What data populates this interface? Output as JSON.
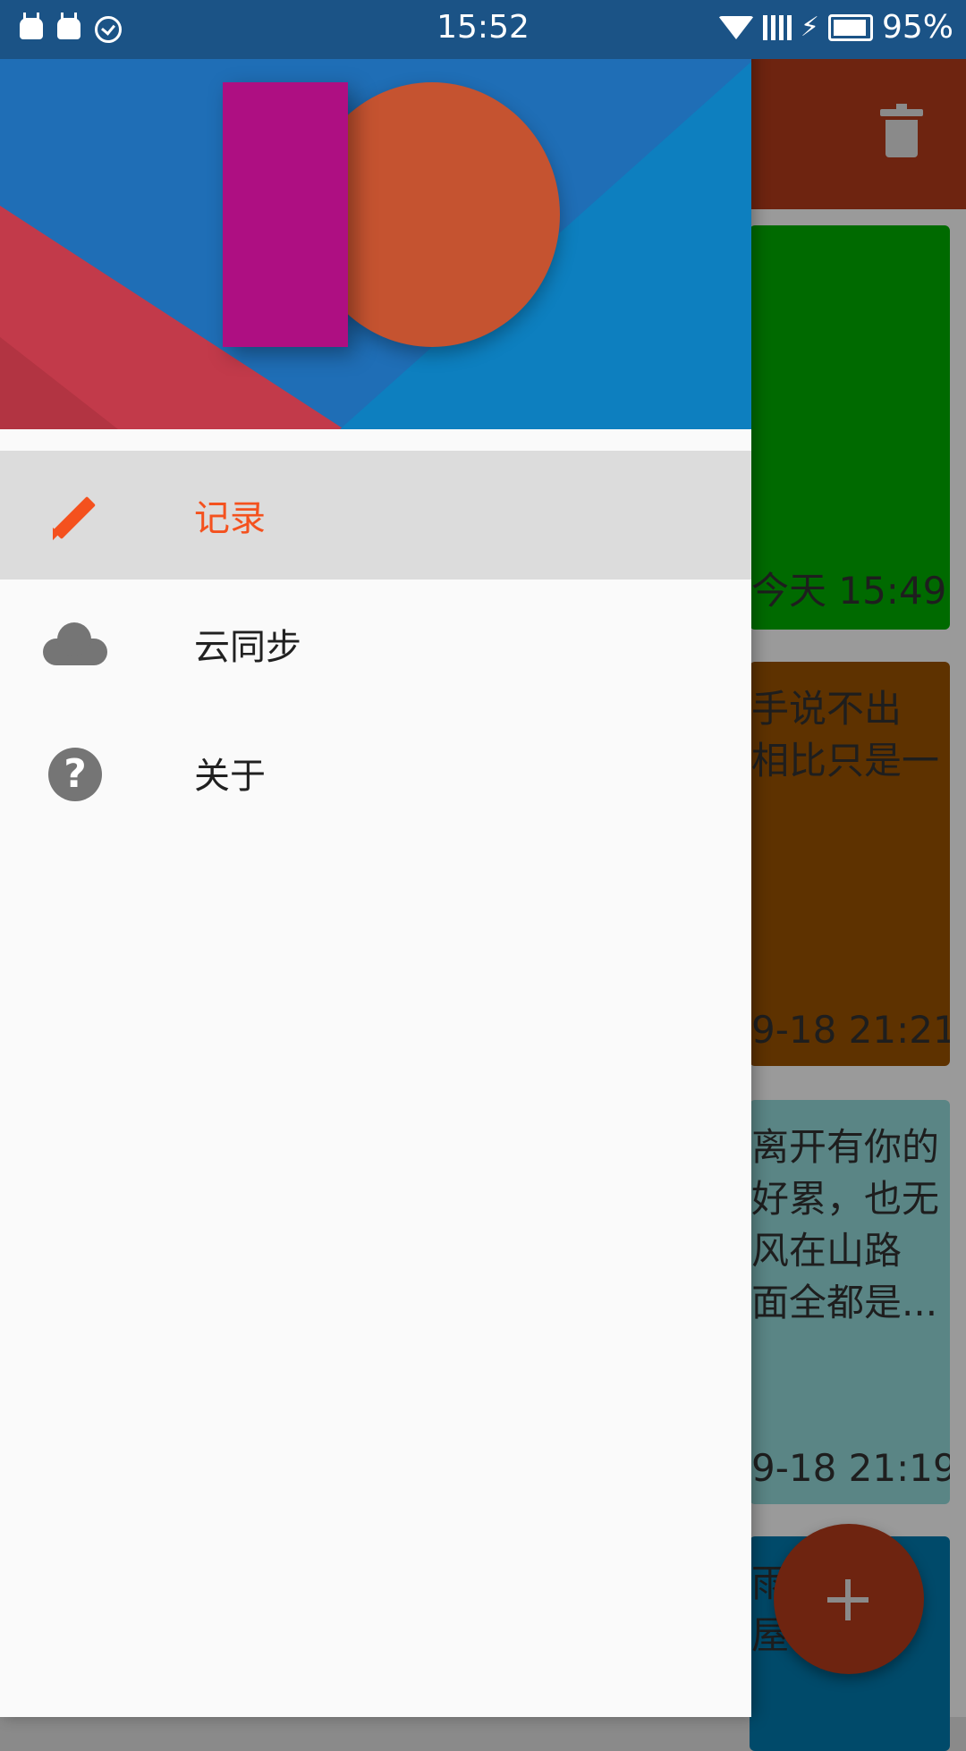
{
  "status_bar": {
    "time": "15:52",
    "battery": "95%"
  },
  "background_app": {
    "notes": [
      {
        "lines": [],
        "time": "今天 15:49"
      },
      {
        "lines": [
          "手说不出",
          "相比只是一"
        ],
        "time": "9-18 21:21"
      },
      {
        "lines": [
          "离开有你的",
          "好累，也无",
          "风在山路",
          "面全都是..."
        ],
        "time": "9-18 21:19"
      },
      {
        "lines": [
          "雨",
          "屋"
        ],
        "time": ""
      }
    ],
    "fab_label": "+"
  },
  "drawer": {
    "menu": [
      {
        "label": "记录",
        "icon": "pencil-icon",
        "active": true
      },
      {
        "label": "云同步",
        "icon": "cloud-icon",
        "active": false
      },
      {
        "label": "关于",
        "icon": "help-icon",
        "active": false
      }
    ]
  },
  "colors": {
    "accent": "#f4511e",
    "status_bar": "#1b5386",
    "active_item_bg": "#dcdcdc"
  }
}
